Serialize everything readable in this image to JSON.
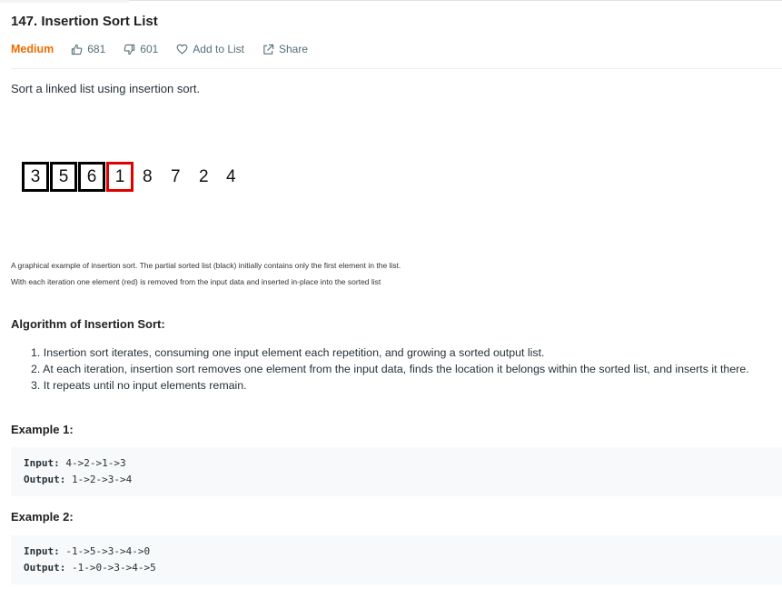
{
  "problem": {
    "title": "147. Insertion Sort List",
    "difficulty": "Medium",
    "likes": "681",
    "dislikes": "601",
    "add_to_list_label": "Add to List",
    "share_label": "Share",
    "description": "Sort a linked list using insertion sort."
  },
  "animation": {
    "sorted": [
      "3",
      "5",
      "6"
    ],
    "current": "1",
    "remaining": [
      "8",
      "7",
      "2",
      "4"
    ],
    "current_color": "#e00000"
  },
  "caption": {
    "line1": "A graphical example of insertion sort. The partial sorted list (black) initially contains only the first element in the list.",
    "line2": "With each iteration one element (red) is removed from the input data and inserted in-place into the sorted list"
  },
  "algorithm": {
    "heading": "Algorithm of Insertion Sort:",
    "steps": [
      "1. Insertion sort iterates, consuming one input element each repetition, and growing a sorted output list.",
      "2. At each iteration, insertion sort removes one element from the input data, finds the location it belongs within the sorted list, and inserts it there.",
      "3. It repeats until no input elements remain."
    ]
  },
  "examples": [
    {
      "heading": "Example 1:",
      "input_label": "Input:",
      "input": "4->2->1->3",
      "output_label": "Output:",
      "output": "1->2->3->4"
    },
    {
      "heading": "Example 2:",
      "input_label": "Input:",
      "input": "-1->5->3->4->0",
      "output_label": "Output:",
      "output": "-1->0->3->4->5"
    }
  ],
  "colors": {
    "difficulty": "#ef6c00",
    "meta": "#546e7a",
    "code_background": "#f7f9fa"
  },
  "icons": {
    "like": "thumbs-up-icon",
    "dislike": "thumbs-down-icon",
    "add_to_list": "heart-icon",
    "share": "share-icon"
  }
}
